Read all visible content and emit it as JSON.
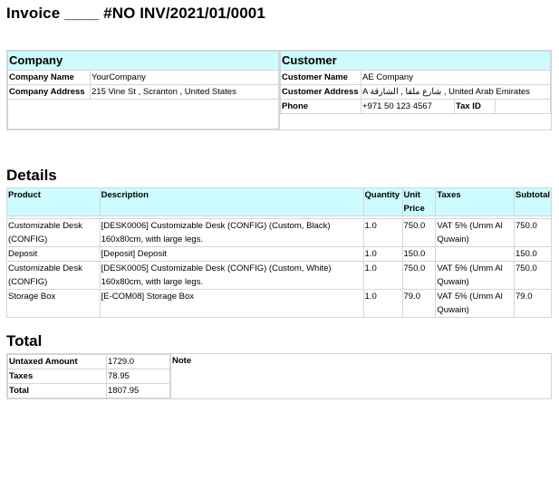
{
  "invoice": {
    "title": "Invoice ____ #NO INV/2021/01/0001"
  },
  "company": {
    "heading": "Company",
    "name_label": "Company Name",
    "name": "YourCompany",
    "address_label": "Company Address",
    "address": "215 Vine St , Scranton , United States"
  },
  "customer": {
    "heading": "Customer",
    "name_label": "Customer Name",
    "name": "AE Company",
    "address_label": "Customer Address",
    "address": "A شارع ملقا , الشارقة , United Arab Emirates",
    "phone_label": "Phone",
    "phone": "+971 50 123 4567",
    "tax_label": "Tax ID",
    "tax": ""
  },
  "details": {
    "heading": "Details",
    "columns": [
      "Product",
      "Description",
      "Quantity",
      "Unit Price",
      "Taxes",
      "Subtotal"
    ],
    "rows": [
      [
        "Customizable Desk (CONFIG)",
        "[DESK0006] Customizable Desk (CONFIG) (Custom, Black) 160x80cm, with large legs.",
        "1.0",
        "750.0",
        "VAT 5% (Umm Al Quwain)",
        "750.0"
      ],
      [
        "Deposit",
        "[Deposit] Deposit",
        "1.0",
        "150.0",
        "",
        "150.0"
      ],
      [
        "Customizable Desk (CONFIG)",
        "[DESK0005] Customizable Desk (CONFIG) (Custom, White) 160x80cm, with large legs.",
        "1.0",
        "750.0",
        "VAT 5% (Umm Al Quwain)",
        "750.0"
      ],
      [
        "Storage Box",
        "[E-COM08] Storage Box",
        "1.0",
        "79.0",
        "VAT 5% (Umm Al Quwain)",
        "79.0"
      ]
    ]
  },
  "total": {
    "heading": "Total",
    "untaxed_label": "Untaxed Amount",
    "untaxed": "1729.0",
    "taxes_label": "Taxes",
    "taxes": "78.95",
    "total_label": "Total",
    "total": "1807.95",
    "note_label": "Note"
  }
}
